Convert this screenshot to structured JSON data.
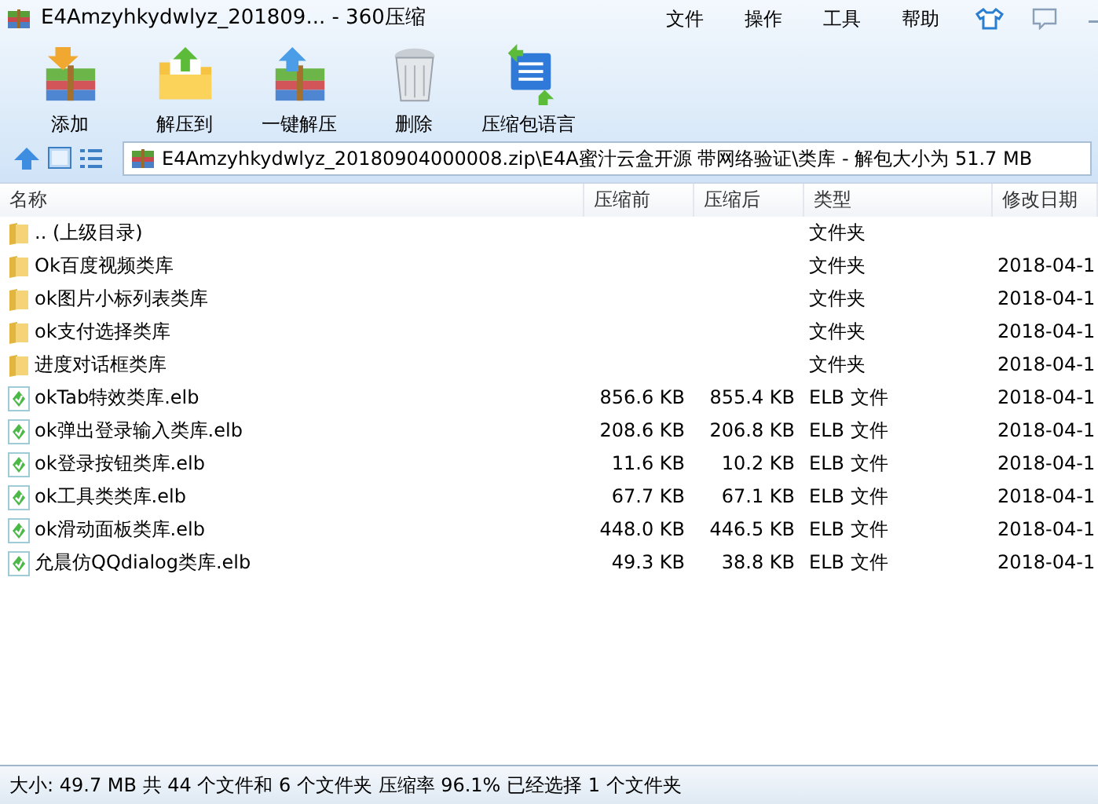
{
  "window": {
    "title": "E4Amzyhkydwlyz_201809... - 360压缩"
  },
  "menu": [
    "文件",
    "操作",
    "工具",
    "帮助"
  ],
  "toolbar": [
    {
      "label": "添加",
      "kind": "add"
    },
    {
      "label": "解压到",
      "kind": "extract"
    },
    {
      "label": "一键解压",
      "kind": "oneclick"
    },
    {
      "label": "删除",
      "kind": "delete"
    },
    {
      "label": "压缩包语言",
      "kind": "language"
    }
  ],
  "address": "E4Amzyhkydwlyz_20180904000008.zip\\E4A蜜汁云盒开源 带网络验证\\类库 - 解包大小为 51.7 MB",
  "table": {
    "columns": [
      "名称",
      "压缩前",
      "压缩后",
      "类型",
      "修改日期"
    ],
    "rows": [
      {
        "kind": "folder",
        "name": ".. (上级目录)",
        "before": "",
        "after": "",
        "type": "文件夹",
        "date": ""
      },
      {
        "kind": "folder",
        "name": "Ok百度视频类库",
        "before": "",
        "after": "",
        "type": "文件夹",
        "date": "2018-04-1"
      },
      {
        "kind": "folder",
        "name": "ok图片小标列表类库",
        "before": "",
        "after": "",
        "type": "文件夹",
        "date": "2018-04-1"
      },
      {
        "kind": "folder",
        "name": "ok支付选择类库",
        "before": "",
        "after": "",
        "type": "文件夹",
        "date": "2018-04-1"
      },
      {
        "kind": "folder",
        "name": "进度对话框类库",
        "before": "",
        "after": "",
        "type": "文件夹",
        "date": "2018-04-1"
      },
      {
        "kind": "file",
        "name": "okTab特效类库.elb",
        "before": "856.6 KB",
        "after": "855.4 KB",
        "type": "ELB 文件",
        "date": "2018-04-1"
      },
      {
        "kind": "file",
        "name": "ok弹出登录输入类库.elb",
        "before": "208.6 KB",
        "after": "206.8 KB",
        "type": "ELB 文件",
        "date": "2018-04-1"
      },
      {
        "kind": "file",
        "name": "ok登录按钮类库.elb",
        "before": "11.6 KB",
        "after": "10.2 KB",
        "type": "ELB 文件",
        "date": "2018-04-1"
      },
      {
        "kind": "file",
        "name": "ok工具类类库.elb",
        "before": "67.7 KB",
        "after": "67.1 KB",
        "type": "ELB 文件",
        "date": "2018-04-1"
      },
      {
        "kind": "file",
        "name": "ok滑动面板类库.elb",
        "before": "448.0 KB",
        "after": "446.5 KB",
        "type": "ELB 文件",
        "date": "2018-04-1"
      },
      {
        "kind": "file",
        "name": "允晨仿QQdialog类库.elb",
        "before": "49.3 KB",
        "after": "38.8 KB",
        "type": "ELB 文件",
        "date": "2018-04-1"
      }
    ]
  },
  "status_bar": "大小: 49.7 MB 共 44 个文件和 6 个文件夹 压缩率 96.1% 已经选择 1 个文件夹"
}
